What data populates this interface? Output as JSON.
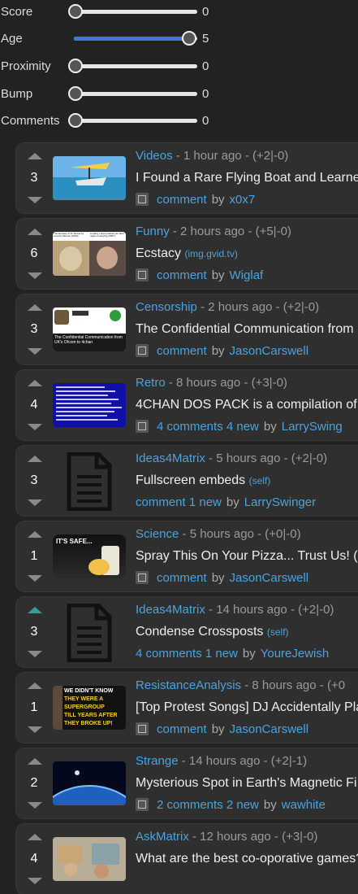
{
  "sliders": [
    {
      "label": "Score",
      "value": "0",
      "level": 0
    },
    {
      "label": "Age",
      "value": "5",
      "level": 1
    },
    {
      "label": "Proximity",
      "value": "0",
      "level": 0
    },
    {
      "label": "Bump",
      "value": "0",
      "level": 0
    },
    {
      "label": "Comments",
      "value": "0",
      "level": 0
    }
  ],
  "posts": [
    {
      "score": "3",
      "category": "Videos",
      "meta": " - 1 hour ago - (+2|-0)",
      "title": "I Found a Rare Flying Boat and Learne",
      "source": "",
      "comments": "comment",
      "author": "x0x7",
      "thumb": "boat",
      "expand": true,
      "upActive": false
    },
    {
      "score": "6",
      "category": "Funny",
      "meta": " - 2 hours ago - (+5|-0)",
      "title": "Ecstacy",
      "source": "(img.gvid.tv)",
      "comments": "comment",
      "author": "Wiglaf",
      "thumb": "statue",
      "expand": true,
      "upActive": false
    },
    {
      "score": "3",
      "category": "Censorship",
      "meta": " - 2 hours ago - (+2|-0)",
      "title": "The Confidential Communication from",
      "source": "",
      "comments": "comment",
      "author": "JasonCarswell",
      "thumb": "confidential",
      "expand": true,
      "upActive": false
    },
    {
      "score": "4",
      "category": "Retro",
      "meta": " - 8 hours ago - (+3|-0)",
      "title": "4CHAN DOS PACK is a compilation of",
      "source": "",
      "comments": "4 comments 4 new",
      "author": "LarrySwing",
      "thumb": "dos",
      "expand": true,
      "upActive": false
    },
    {
      "score": "3",
      "category": "Ideas4Matrix",
      "meta": " - 5 hours ago - (+2|-0)",
      "title": "Fullscreen embeds",
      "source": "(self)",
      "comments": "comment 1 new",
      "author": "LarrySwinger",
      "thumb": "doc",
      "expand": false,
      "upActive": false
    },
    {
      "score": "1",
      "category": "Science",
      "meta": " - 5 hours ago - (+0|-0)",
      "title": "Spray This On Your Pizza... Trust Us! (",
      "source": "",
      "comments": "comment",
      "author": "JasonCarswell",
      "thumb": "safe",
      "expand": true,
      "upActive": false
    },
    {
      "score": "3",
      "category": "Ideas4Matrix",
      "meta": " - 14 hours ago - (+2|-0)",
      "title": "Condense Crossposts",
      "source": "(self)",
      "comments": "4 comments 1 new",
      "author": "YoureJewish",
      "thumb": "doc",
      "expand": false,
      "upActive": true
    },
    {
      "score": "1",
      "category": "ResistanceAnalysis",
      "meta": " - 8 hours ago - (+0",
      "title": "[Top Protest Songs] DJ Accidentally Pla",
      "source": "",
      "comments": "comment",
      "author": "JasonCarswell",
      "thumb": "supergroup",
      "expand": true,
      "upActive": false
    },
    {
      "score": "2",
      "category": "Strange",
      "meta": " - 14 hours ago - (+2|-1)",
      "title": "Mysterious Spot in Earth's Magnetic Fi",
      "source": "",
      "comments": "2 comments 2 new",
      "author": "wawhite",
      "thumb": "earth",
      "expand": true,
      "upActive": false
    },
    {
      "score": "4",
      "category": "AskMatrix",
      "meta": " - 12 hours ago - (+3|-0)",
      "title": "What are the best co-oporative games?",
      "source": "",
      "comments": "",
      "author": "",
      "thumb": "games",
      "expand": false,
      "upActive": false
    }
  ],
  "thumb_text": {
    "statue_left": "The Ecstasy of St Teresa by Lorenzo Bernini (1652)",
    "statue_right": "Lindsey Lohan passed out after night of partying (2007)",
    "confidential": "The Confidential Communication from UK's Ofcom to 4chan",
    "safe": "IT'S SAFE...",
    "supergroup": [
      "WE DIDN'T KNOW",
      "THEY WERE A",
      "SUPERGROUP",
      "TILL YEARS AFTER",
      "THEY BROKE UP!"
    ]
  },
  "labels": {
    "by": "by"
  }
}
